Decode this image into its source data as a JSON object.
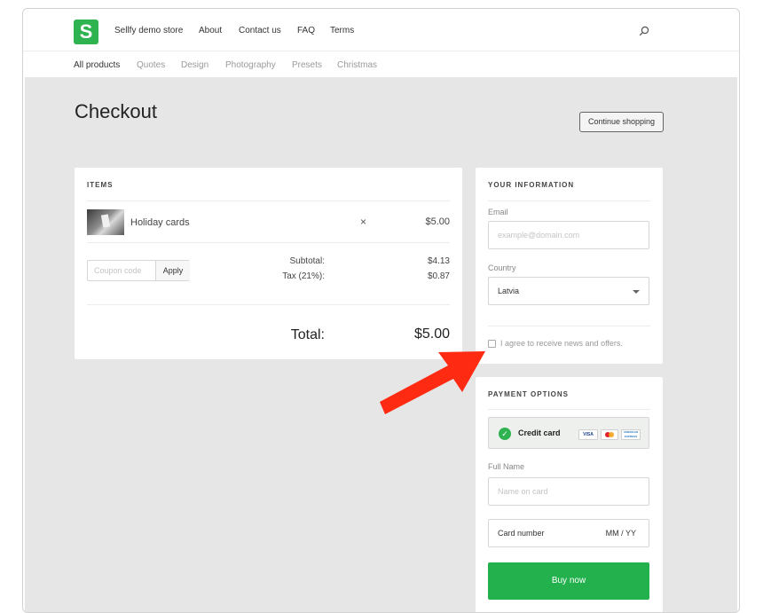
{
  "brand": {
    "logo_letter": "S",
    "logo_color": "#2eb350"
  },
  "nav": {
    "store": "Sellfy demo store",
    "about": "About",
    "contact": "Contact us",
    "faq": "FAQ",
    "terms": "Terms",
    "search_icon": "search-icon"
  },
  "categories": [
    "All products",
    "Quotes",
    "Design",
    "Photography",
    "Presets",
    "Christmas"
  ],
  "page": {
    "title": "Checkout",
    "continue_label": "Continue shopping"
  },
  "items": {
    "heading": "ITEMS",
    "list": [
      {
        "name": "Holiday cards",
        "remove": "×",
        "price": "$5.00"
      }
    ],
    "coupon_placeholder": "Coupon code",
    "apply_label": "Apply",
    "subtotal_label": "Subtotal:",
    "subtotal_value": "$4.13",
    "tax_label": "Tax (21%):",
    "tax_value": "$0.87",
    "total_label": "Total:",
    "total_value": "$5.00"
  },
  "info": {
    "heading": "YOUR INFORMATION",
    "email_label": "Email",
    "email_placeholder": "example@domain.com",
    "country_label": "Country",
    "country_value": "Latvia",
    "agree_label": "I agree to receive news and offers."
  },
  "payment": {
    "heading": "PAYMENT OPTIONS",
    "method": "Credit card",
    "method_check": "✓",
    "card_logos": [
      "VISA",
      "mastercard",
      "AMERICAN EXPRESS"
    ],
    "fullname_label": "Full Name",
    "fullname_placeholder": "Name on card",
    "card_number_label": "Card number",
    "expiry_label": "MM / YY",
    "buy_label": "Buy now",
    "buy_color": "#22b14c"
  },
  "annotation": {
    "arrow_color": "#ff2a12"
  }
}
